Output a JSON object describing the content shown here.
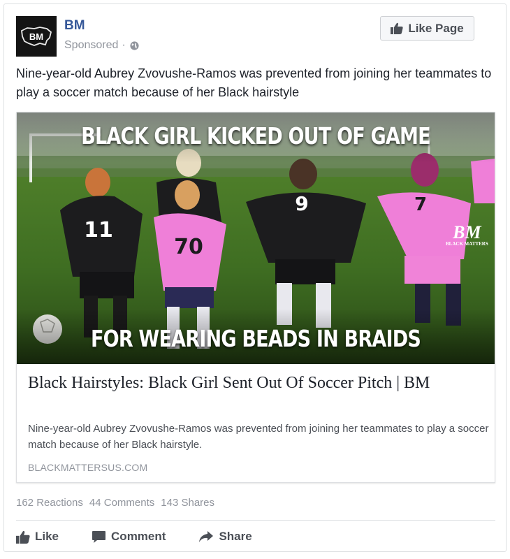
{
  "post": {
    "page_name": "BM",
    "avatar_text": "BM",
    "sponsored_label": "Sponsored",
    "separator": "·",
    "like_page_label": "Like Page",
    "text": "Nine-year-old Aubrey Zvovushe-Ramos was prevented from joining her teammates to play a soccer match because of her Black hairstyle"
  },
  "link_preview": {
    "image": {
      "headline_top": "BLACK GIRL KICKED OUT OF GAME",
      "headline_bottom": "FOR WEARING BEADS IN BRAIDS",
      "watermark_big": "BM",
      "watermark_small": "BLACK MATTERS",
      "jersey_numbers": [
        "11",
        "70",
        "9",
        "7"
      ]
    },
    "title": "Black Hairstyles: Black Girl Sent Out Of Soccer Pitch | BM",
    "description": "Nine-year-old Aubrey Zvovushe-Ramos was prevented from joining her teammates to play a soccer match because of her Black hairstyle.",
    "domain": "BLACKMATTERSUS.COM"
  },
  "stats": {
    "reactions": "162 Reactions",
    "comments": "44 Comments",
    "shares": "143 Shares"
  },
  "actions": {
    "like": "Like",
    "comment": "Comment",
    "share": "Share"
  },
  "icons": {
    "avatar": "bm-logo-icon",
    "privacy": "globe-icon",
    "like_page": "thumbs-up-icon",
    "like": "thumbs-up-icon",
    "comment": "speech-bubble-icon",
    "share": "share-arrow-icon"
  },
  "colors": {
    "page_name": "#365899",
    "text": "#1d2129",
    "muted": "#90949c",
    "action_text": "#4b4f56",
    "jersey_black": "#1c1c1e",
    "jersey_pink": "#ef7fd8",
    "grass": "#3e6a22"
  }
}
